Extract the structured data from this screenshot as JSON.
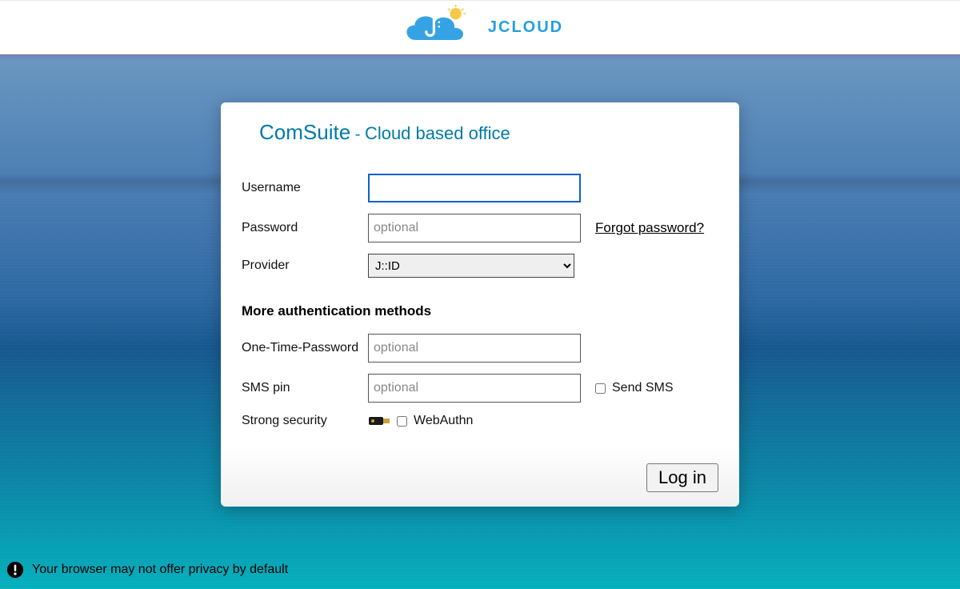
{
  "header": {
    "brand": "JCLOUD"
  },
  "card": {
    "title_main": "ComSuite",
    "title_sep": " - ",
    "title_sub": "Cloud based office",
    "username_label": "Username",
    "username_value": "",
    "password_label": "Password",
    "password_placeholder": "optional",
    "forgot_link": "Forgot password?",
    "provider_label": "Provider",
    "provider_selected": "J::ID",
    "more_heading": "More authentication methods",
    "otp_label": "One-Time-Password",
    "otp_placeholder": "optional",
    "sms_label": "SMS pin",
    "sms_placeholder": "optional",
    "send_sms_label": "Send SMS",
    "strong_label": "Strong security",
    "webauthn_label": "WebAuthn",
    "login_button": "Log in"
  },
  "warning": {
    "text": "Your browser may not offer privacy by default"
  }
}
